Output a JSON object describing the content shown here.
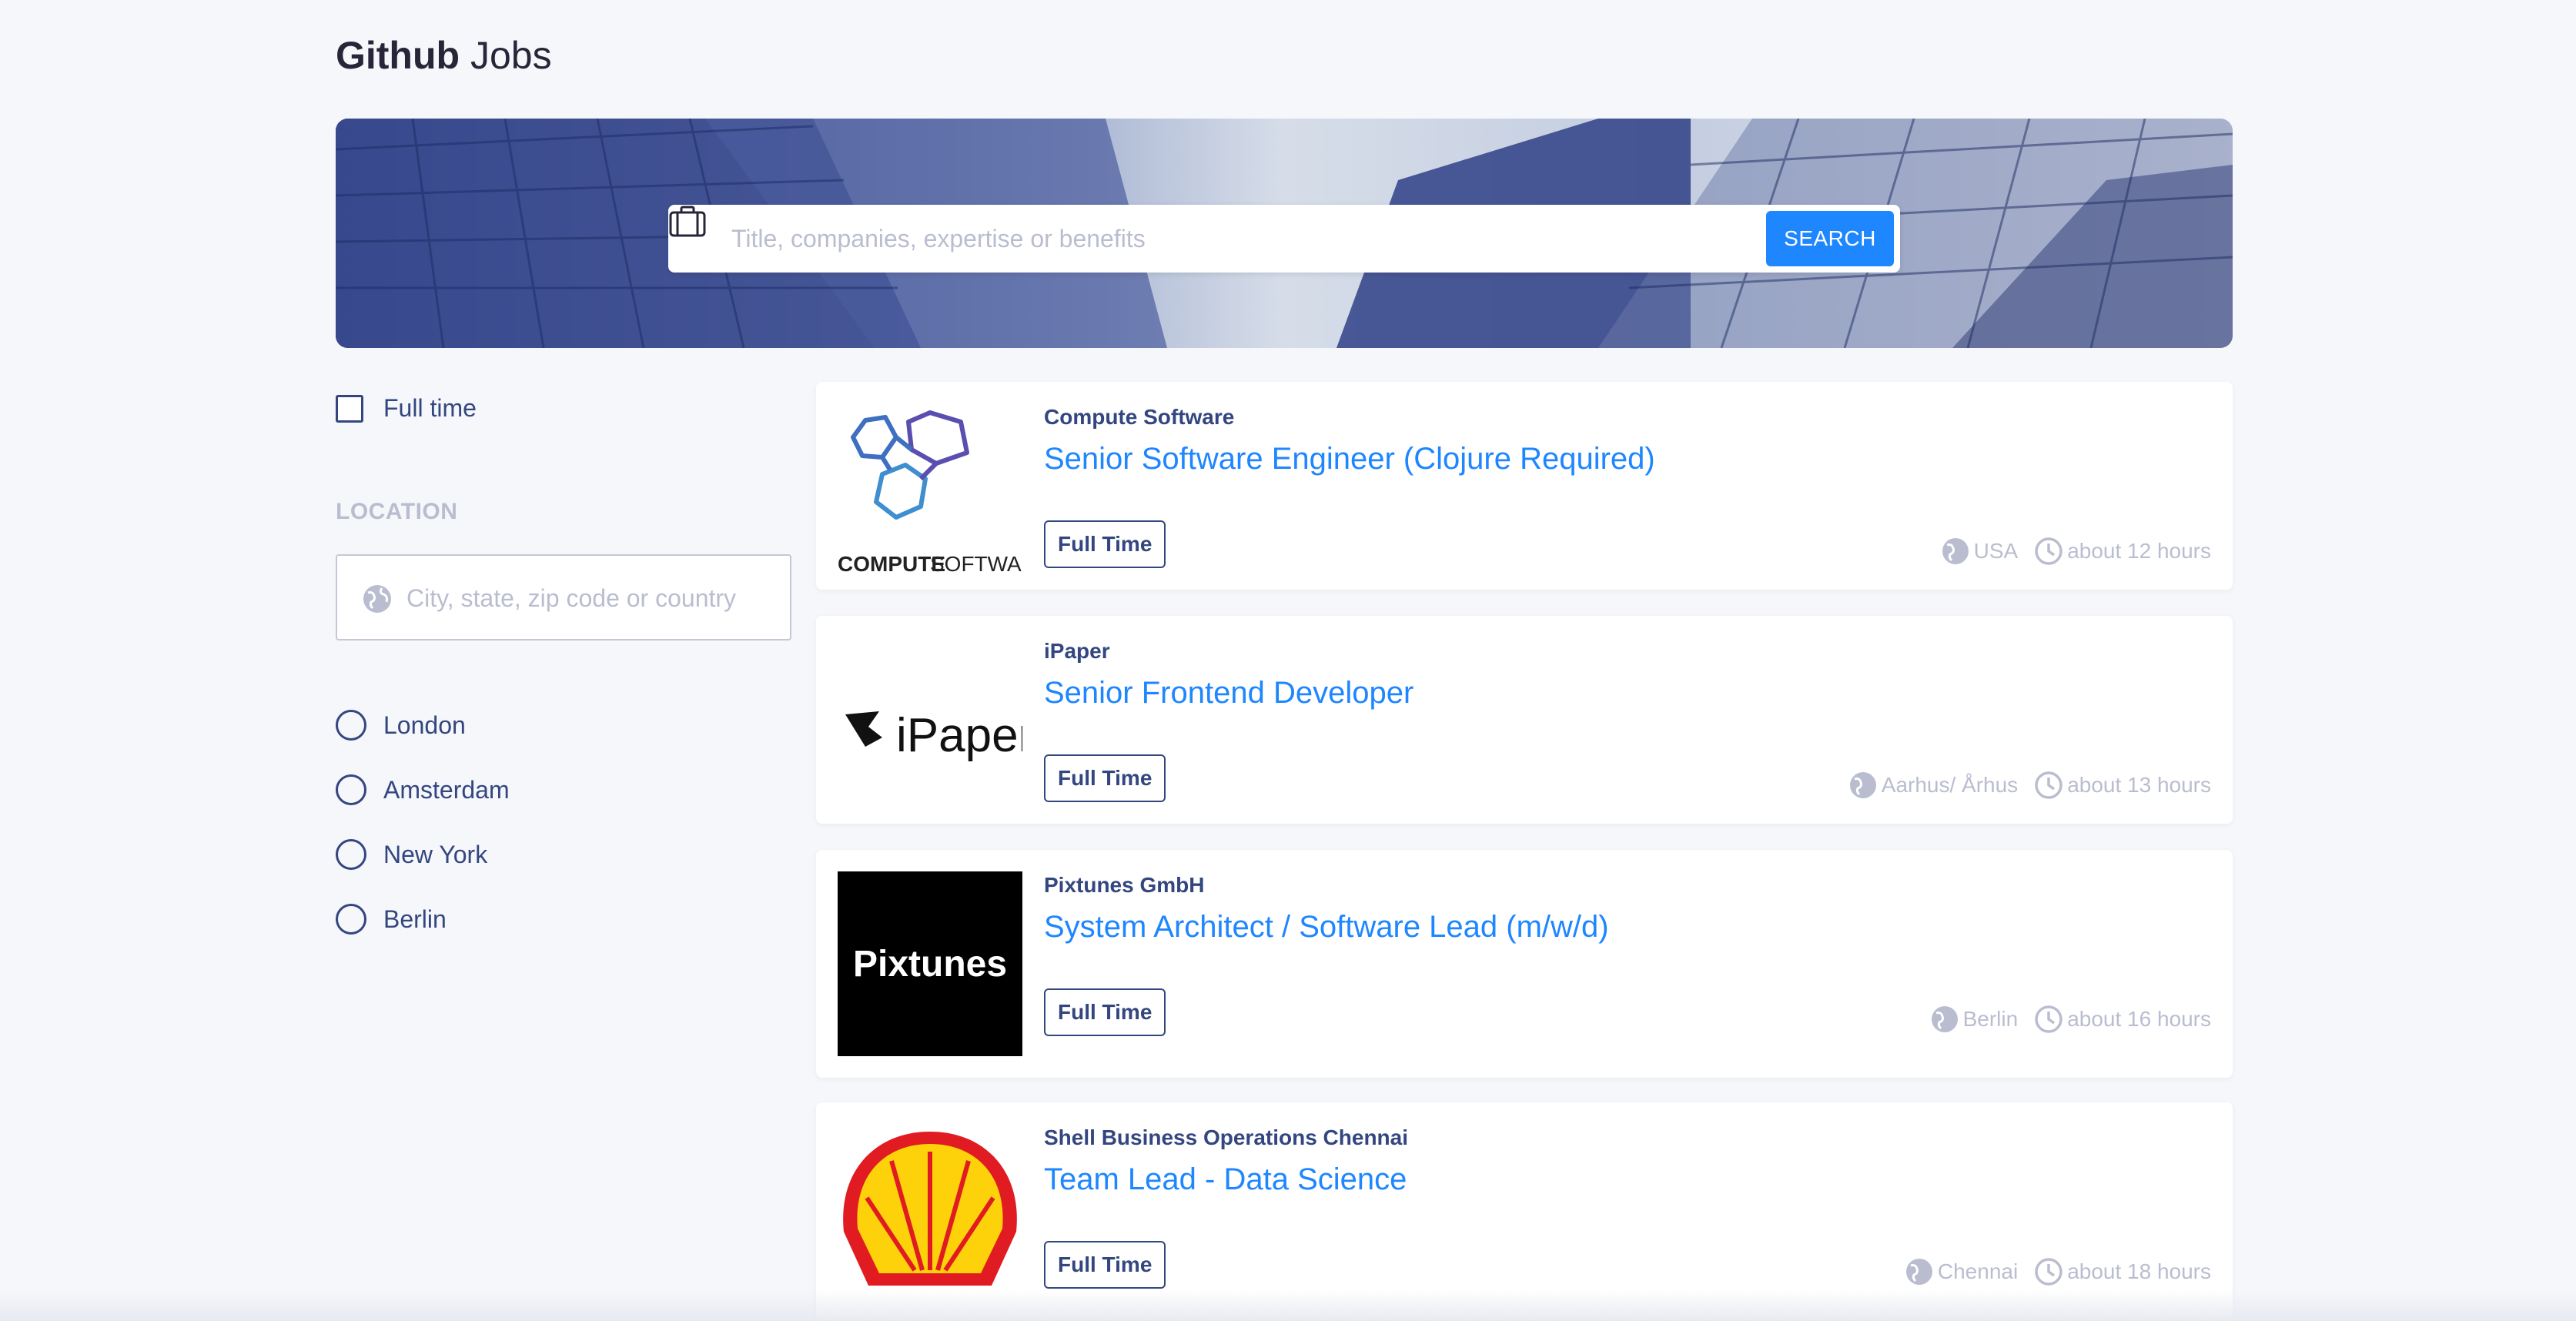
{
  "header": {
    "title_bold": "Github",
    "title_rest": "Jobs"
  },
  "search": {
    "placeholder": "Title, companies, expertise or benefits",
    "icon": "briefcase-icon",
    "button_label": "SEARCH"
  },
  "filters": {
    "full_time_label": "Full time",
    "full_time_checked": false,
    "location_heading": "LOCATION",
    "location_placeholder": "City, state, zip code or country",
    "locations": [
      {
        "label": "London"
      },
      {
        "label": "Amsterdam"
      },
      {
        "label": "New York"
      },
      {
        "label": "Berlin"
      }
    ]
  },
  "jobs": [
    {
      "company": "Compute Software",
      "title": "Senior Software Engineer (Clojure Required)",
      "tag": "Full Time",
      "location": "USA",
      "time": "about 12 hours",
      "logo_text": "COMPUTE SOFTWARE",
      "logo_bold": "COMPUTE",
      "logo_light": "SOFTWARE"
    },
    {
      "company": "iPaper",
      "title": "Senior Frontend Developer",
      "tag": "Full Time",
      "location": "Aarhus/ Århus",
      "time": "about 13 hours",
      "logo_text": "iPaper"
    },
    {
      "company": "Pixtunes GmbH",
      "title": "System Architect / Software Lead (m/w/d)",
      "tag": "Full Time",
      "location": "Berlin",
      "time": "about 16 hours",
      "logo_text": "Pixtunes"
    },
    {
      "company": "Shell Business Operations Chennai",
      "title": "Team Lead - Data Science",
      "tag": "Full Time",
      "location": "Chennai",
      "time": "about 18 hours",
      "logo_text": ""
    }
  ],
  "colors": {
    "accent": "#1e86ff",
    "text": "#334680",
    "muted": "#b9bdcf",
    "background": "#f6f7fb"
  }
}
